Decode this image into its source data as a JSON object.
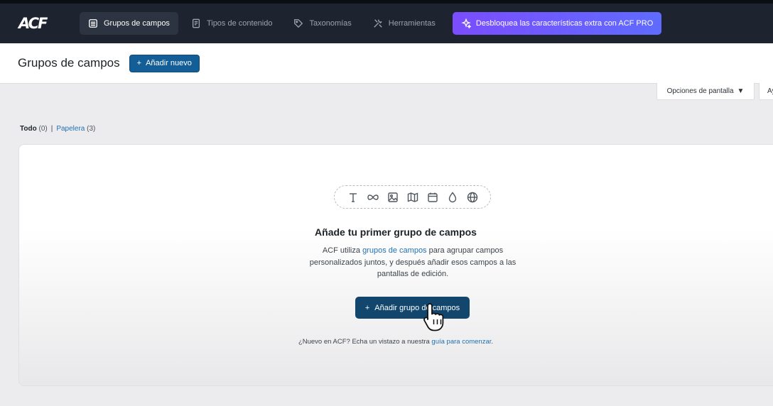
{
  "topbar": {
    "logo": "ACF",
    "nav": [
      {
        "label": "Grupos de campos",
        "icon": "list-icon",
        "active": true
      },
      {
        "label": "Tipos de contenido",
        "icon": "document-icon",
        "active": false
      },
      {
        "label": "Taxonomías",
        "icon": "tag-icon",
        "active": false
      },
      {
        "label": "Herramientas",
        "icon": "tools-icon",
        "active": false
      }
    ],
    "pro_label": "Desbloquea las características extra con ACF PRO"
  },
  "header": {
    "title": "Grupos de campos",
    "add_new": "Añadir nuevo"
  },
  "screen_options": "Opciones de pantalla",
  "help_tab": "Ay",
  "filters": {
    "all_label": "Todo",
    "all_count": "(0)",
    "separator": "|",
    "trash_label": "Papelera",
    "trash_count": "(3)"
  },
  "empty_state": {
    "icons": [
      "text-icon",
      "link-icon",
      "image-icon",
      "map-icon",
      "calendar-icon",
      "color-drop-icon",
      "globe-icon"
    ],
    "title": "Añade tu primer grupo de campos",
    "desc_before": "ACF utiliza ",
    "desc_link": "grupos de campos",
    "desc_after": " para agrupar campos personalizados juntos, y después añadir esos campos a las pantallas de edición.",
    "cta": "Añadir grupo de campos",
    "footnote_before": "¿Nuevo en ACF? Echa un vistazo a nuestra ",
    "footnote_link": "guía para comenzar",
    "footnote_after": "."
  },
  "colors": {
    "topbar_bg": "#1d2430",
    "primary": "#135e96",
    "cta": "#13466d",
    "pro_gradient_start": "#7b4dff",
    "pro_gradient_end": "#5f6bff",
    "link": "#2271b1"
  }
}
